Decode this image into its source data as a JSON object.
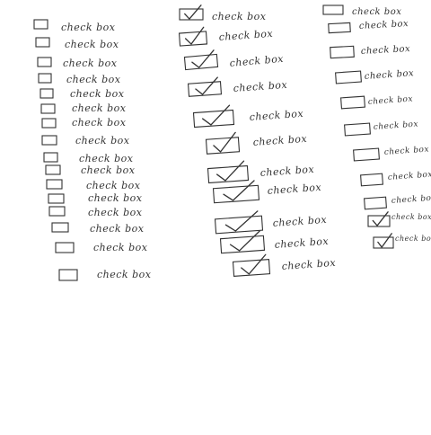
{
  "sheet": {
    "label_text": "check box",
    "columns": [
      {
        "name": "left",
        "items": [
          {
            "checked": false
          },
          {
            "checked": false
          },
          {
            "checked": false
          },
          {
            "checked": false
          },
          {
            "checked": false
          },
          {
            "checked": false
          },
          {
            "checked": false
          },
          {
            "checked": false
          },
          {
            "checked": false
          },
          {
            "checked": false
          },
          {
            "checked": false
          },
          {
            "checked": false
          },
          {
            "checked": false
          },
          {
            "checked": false
          },
          {
            "checked": false
          },
          {
            "checked": false
          }
        ]
      },
      {
        "name": "middle",
        "items": [
          {
            "checked": true
          },
          {
            "checked": true
          },
          {
            "checked": true
          },
          {
            "checked": true
          },
          {
            "checked": true
          },
          {
            "checked": true
          },
          {
            "checked": true
          },
          {
            "checked": true
          },
          {
            "checked": true
          },
          {
            "checked": true
          },
          {
            "checked": true
          }
        ]
      },
      {
        "name": "right",
        "items": [
          {
            "checked": false
          },
          {
            "checked": false
          },
          {
            "checked": false
          },
          {
            "checked": false
          },
          {
            "checked": false
          },
          {
            "checked": false
          },
          {
            "checked": false
          },
          {
            "checked": false
          },
          {
            "checked": false
          },
          {
            "checked": true
          },
          {
            "checked": true
          }
        ]
      }
    ]
  }
}
